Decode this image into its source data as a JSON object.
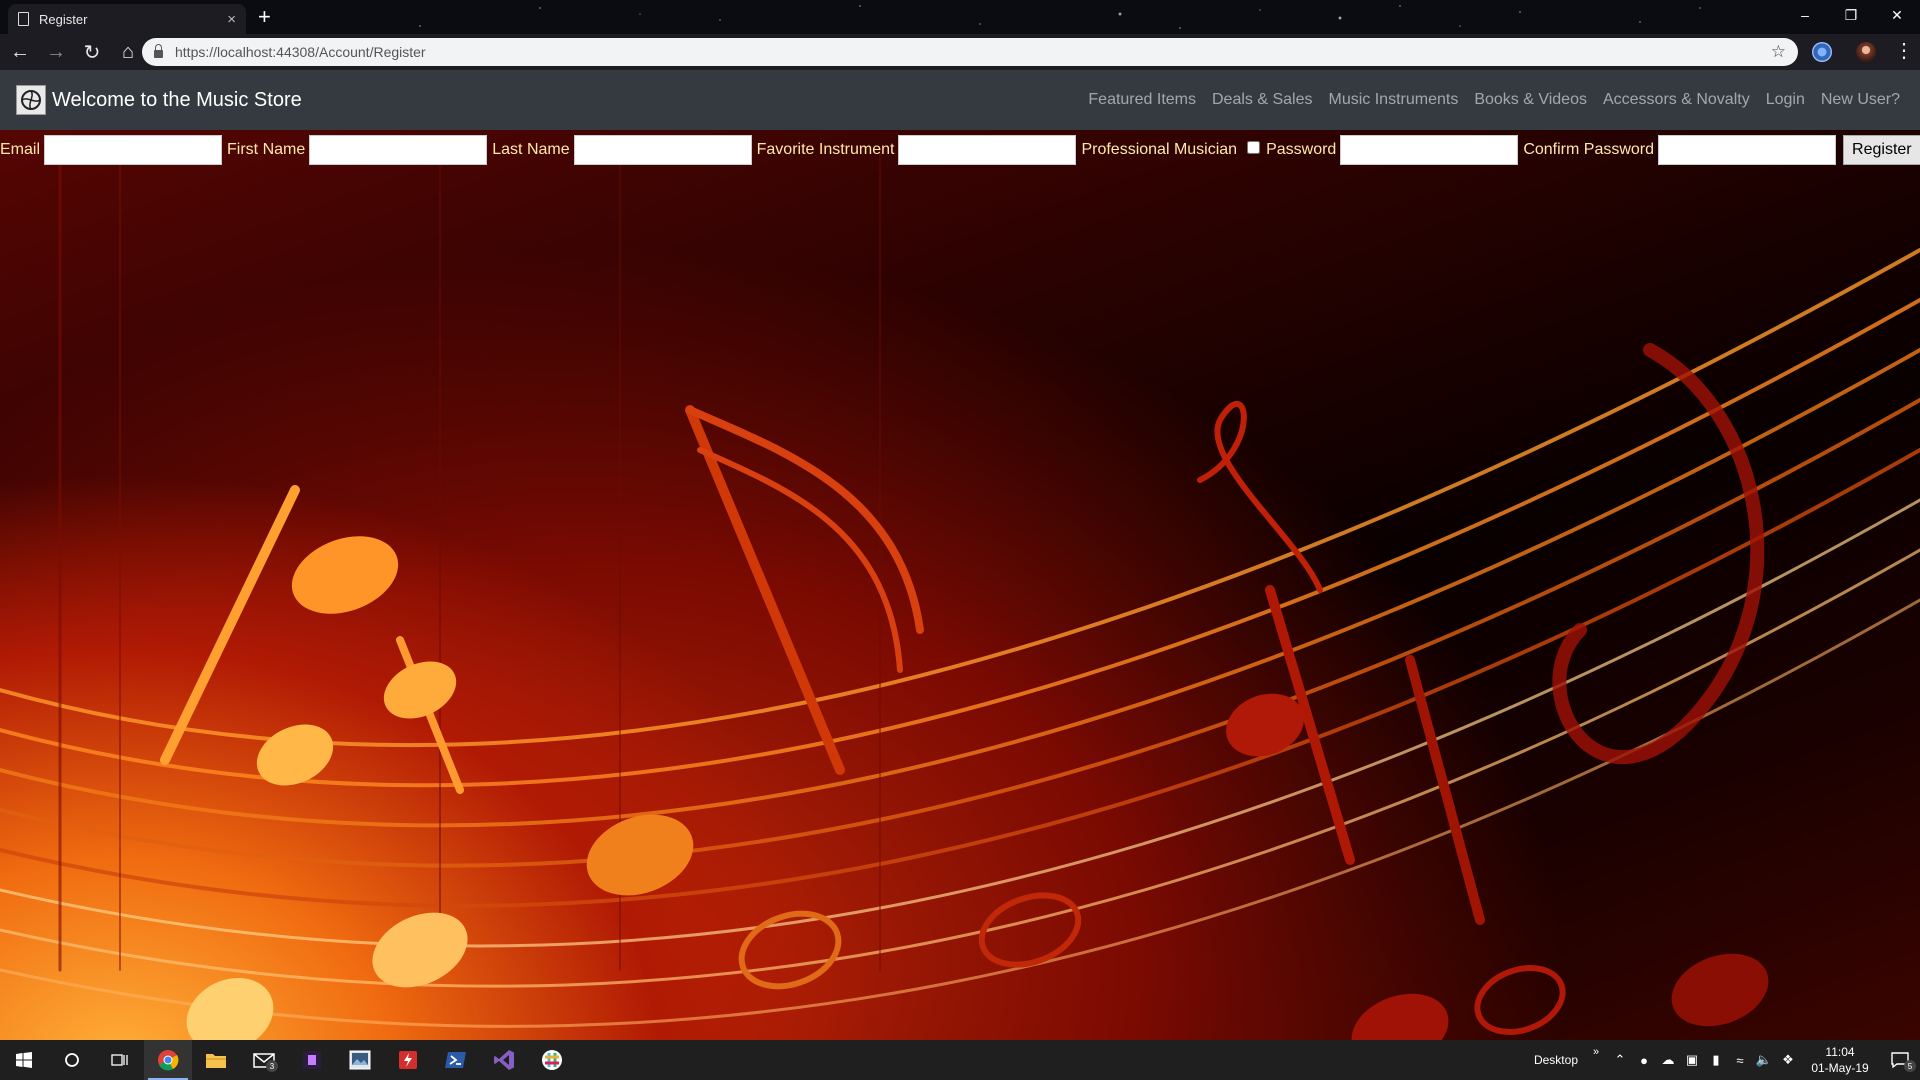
{
  "browser": {
    "tab_title": "Register",
    "url": "https://localhost:44308/Account/Register",
    "new_tab": "+",
    "close_tab": "×"
  },
  "site": {
    "brand": "Welcome to the Music Store",
    "nav": [
      "Featured Items",
      "Deals & Sales",
      "Music Instruments",
      "Books & Videos",
      "Accessors & Novalty",
      "Login",
      "New User?"
    ]
  },
  "form": {
    "email_label": "Email",
    "email_value": "",
    "first_name_label": "First Name",
    "first_name_value": "",
    "last_name_label": "Last Name",
    "last_name_value": "",
    "instrument_label": "Favorite Instrument",
    "instrument_value": "",
    "professional_label": "Professional Musician",
    "professional_checked": false,
    "password_label": "Password",
    "password_value": "",
    "confirm_label": "Confirm Password",
    "confirm_value": "",
    "submit_label": "Register"
  },
  "taskbar": {
    "desktop_label": "Desktop",
    "time": "11:04",
    "date": "01-May-19",
    "mail_badge": "3",
    "notif_badge": "5"
  },
  "colors": {
    "navbar": "#343a40",
    "form_label": "#ffe9a8"
  }
}
